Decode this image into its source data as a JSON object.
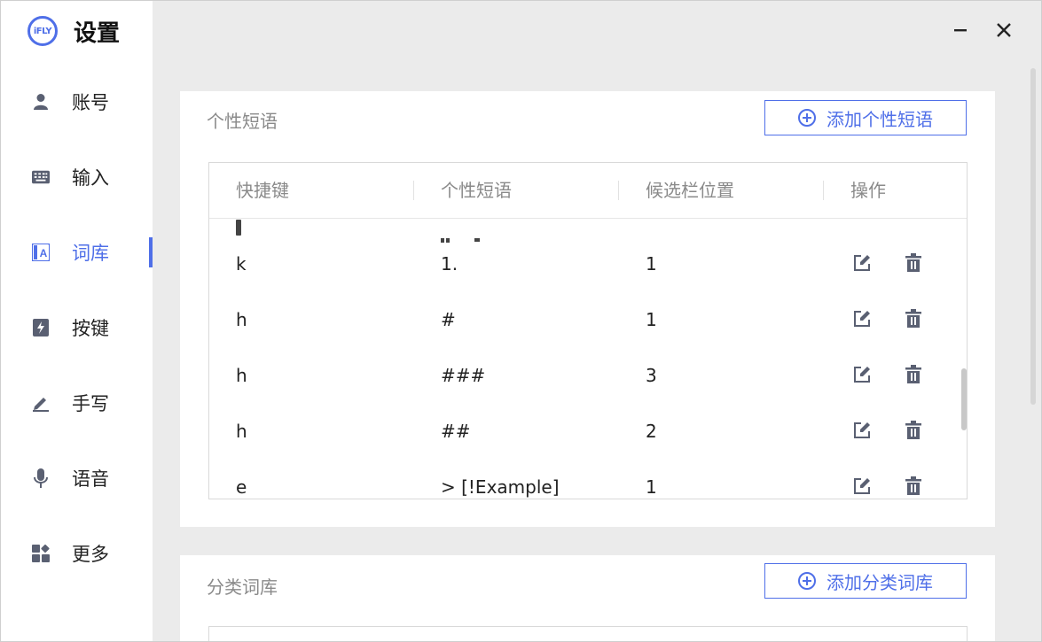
{
  "app": {
    "logo_text": "iFLY",
    "title": "设置"
  },
  "sidebar": {
    "items": [
      {
        "label": "账号",
        "icon": "user-icon",
        "active": false
      },
      {
        "label": "输入",
        "icon": "keyboard-icon",
        "active": false
      },
      {
        "label": "词库",
        "icon": "dictionary-icon",
        "active": true
      },
      {
        "label": "按键",
        "icon": "key-icon",
        "active": false
      },
      {
        "label": "手写",
        "icon": "pen-icon",
        "active": false
      },
      {
        "label": "语音",
        "icon": "microphone-icon",
        "active": false
      },
      {
        "label": "更多",
        "icon": "more-grid-icon",
        "active": false
      }
    ]
  },
  "colors": {
    "accent": "#4f6fe8",
    "bg": "#ebebeb",
    "icon": "#5a6072"
  },
  "phrases": {
    "title": "个性短语",
    "add_label": "添加个性短语",
    "columns": [
      "快捷键",
      "个性短语",
      "候选栏位置",
      "操作"
    ],
    "rows": [
      {
        "key": "k",
        "phrase": "1.",
        "position": "1"
      },
      {
        "key": "h",
        "phrase": "#",
        "position": "1"
      },
      {
        "key": "h",
        "phrase": "###",
        "position": "3"
      },
      {
        "key": "h",
        "phrase": "##",
        "position": "2"
      },
      {
        "key": "e",
        "phrase": "> [!Example]",
        "position": "1"
      }
    ]
  },
  "categories": {
    "title": "分类词库",
    "add_label": "添加分类词库"
  }
}
